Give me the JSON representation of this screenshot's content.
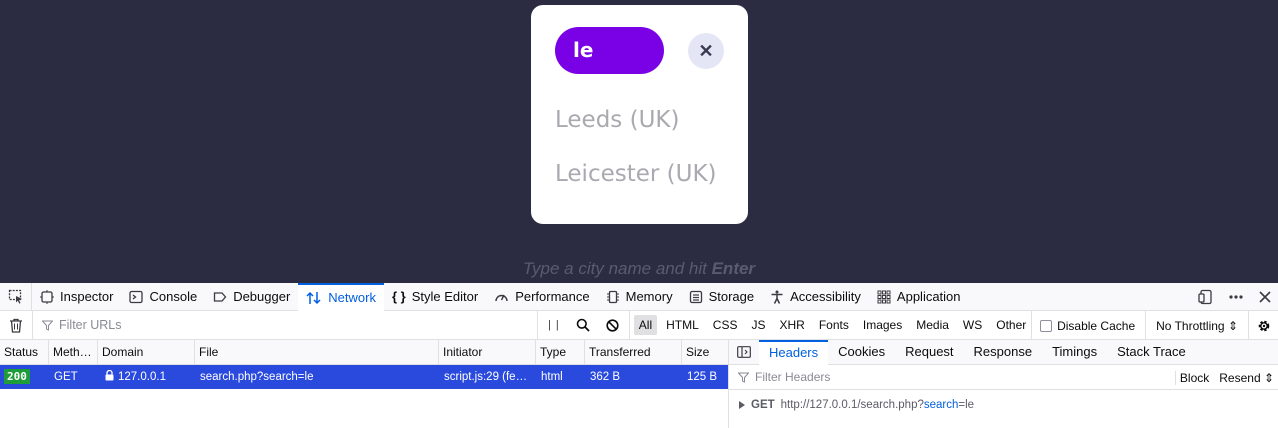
{
  "page": {
    "search_value": "le",
    "close_symbol": "✕",
    "results": [
      "Leeds (UK)",
      "Leicester (UK)"
    ],
    "hint_prefix": "Type a city name and hit ",
    "hint_key": "Enter"
  },
  "devtools": {
    "tabs": [
      {
        "label": "Inspector",
        "icon": "inspector-icon"
      },
      {
        "label": "Console",
        "icon": "console-icon"
      },
      {
        "label": "Debugger",
        "icon": "debugger-icon"
      },
      {
        "label": "Network",
        "icon": "network-icon",
        "active": true
      },
      {
        "label": "Style Editor",
        "icon": "style-editor-icon"
      },
      {
        "label": "Performance",
        "icon": "performance-icon"
      },
      {
        "label": "Memory",
        "icon": "memory-icon"
      },
      {
        "label": "Storage",
        "icon": "storage-icon"
      },
      {
        "label": "Accessibility",
        "icon": "accessibility-icon"
      },
      {
        "label": "Application",
        "icon": "application-icon"
      }
    ],
    "toolbar": {
      "filter_placeholder": "Filter URLs",
      "pause_symbol": "| |",
      "type_filters": [
        "All",
        "HTML",
        "CSS",
        "JS",
        "XHR",
        "Fonts",
        "Images",
        "Media",
        "WS",
        "Other"
      ],
      "active_filter": "All",
      "disable_cache": "Disable Cache",
      "throttling": "No Throttling ⇕"
    },
    "table": {
      "columns": [
        "Status",
        "Meth…",
        "Domain",
        "File",
        "Initiator",
        "Type",
        "Transferred",
        "Size"
      ],
      "rows": [
        {
          "status": "200",
          "method": "GET",
          "domain": "127.0.0.1",
          "file": "search.php?search=le",
          "initiator": "script.js:29 (fe…",
          "type": "html",
          "transferred": "362 B",
          "size": "125 B"
        }
      ]
    },
    "details": {
      "tabs": [
        "Headers",
        "Cookies",
        "Request",
        "Response",
        "Timings",
        "Stack Trace"
      ],
      "active_tab": "Headers",
      "filter_placeholder": "Filter Headers",
      "block_label": "Block",
      "resend_label": "Resend ⇕",
      "request_method": "GET",
      "request_url_base": "http://127.0.0.1/search.php?",
      "request_param_key": "search",
      "request_param_rest": "=le"
    }
  },
  "colors": {
    "page_bg": "#2b2c42",
    "accent_purple": "#7a00e6",
    "devtools_blue": "#0060df",
    "selected_row": "#2a4ade",
    "status_ok": "#1f9c3a"
  }
}
